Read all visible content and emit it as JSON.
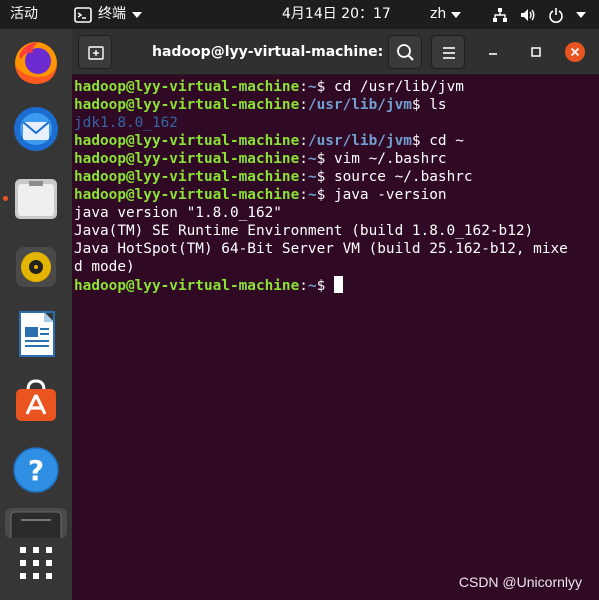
{
  "topbar": {
    "activities": "活动",
    "app_name": "终端",
    "clock": "4月14日  20：17",
    "lang": "zh"
  },
  "dock": {
    "items": [
      {
        "icon": "firefox-icon"
      },
      {
        "icon": "thunderbird-icon"
      },
      {
        "icon": "files-icon",
        "running": true
      },
      {
        "icon": "rhythmbox-icon"
      },
      {
        "icon": "libreoffice-writer-icon"
      },
      {
        "icon": "ubuntu-software-icon"
      },
      {
        "icon": "help-icon"
      },
      {
        "icon": "terminal-icon"
      },
      {
        "icon": "show-applications-icon"
      }
    ]
  },
  "window": {
    "title": "hadoop@lyy-virtual-machine: ~"
  },
  "terminal": {
    "lines": [
      {
        "user": "hadoop@lyy-virtual-machine",
        "sep": ":",
        "path": "~",
        "prompt": "$ ",
        "cmd": "cd /usr/lib/jvm"
      },
      {
        "user": "hadoop@lyy-virtual-machine",
        "sep": ":",
        "path": "/usr/lib/jvm",
        "prompt": "$ ",
        "cmd": "ls"
      },
      {
        "dir": "jdk1.8.0_162"
      },
      {
        "user": "hadoop@lyy-virtual-machine",
        "sep": ":",
        "path": "/usr/lib/jvm",
        "prompt": "$ ",
        "cmd": "cd ~"
      },
      {
        "user": "hadoop@lyy-virtual-machine",
        "sep": ":",
        "path": "~",
        "prompt": "$ ",
        "cmd": "vim ~/.bashrc"
      },
      {
        "user": "hadoop@lyy-virtual-machine",
        "sep": ":",
        "path": "~",
        "prompt": "$ ",
        "cmd": "source ~/.bashrc"
      },
      {
        "user": "hadoop@lyy-virtual-machine",
        "sep": ":",
        "path": "~",
        "prompt": "$ ",
        "cmd": "java -version"
      },
      {
        "out": "java version \"1.8.0_162\""
      },
      {
        "out": "Java(TM) SE Runtime Environment (build 1.8.0_162-b12)"
      },
      {
        "out": "Java HotSpot(TM) 64-Bit Server VM (build 25.162-b12, mixe"
      },
      {
        "out": "d mode)"
      },
      {
        "user": "hadoop@lyy-virtual-machine",
        "sep": ":",
        "path": "~",
        "prompt": "$ ",
        "cmd": ""
      }
    ]
  },
  "watermark": "CSDN @Unicornlyy"
}
